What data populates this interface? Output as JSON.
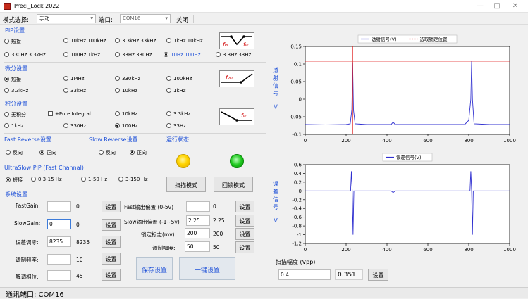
{
  "window": {
    "title": "Preci_Lock 2022",
    "min": "—",
    "max": "□",
    "close": "✕"
  },
  "toolbar": {
    "mode_label": "模式选择:",
    "mode_value": "手动",
    "port_label": "端口:",
    "port_value": "COM16",
    "close_label": "关闭"
  },
  "pip": {
    "title": "PIP设置",
    "row1": [
      "短接",
      "10kHz 100kHz",
      "3.3kHz 33kHz",
      "1kHz 10kHz"
    ],
    "row2": [
      "330Hz 3.3kHz",
      "100Hz 1kHz",
      "33Hz 330Hz",
      "10Hz 100Hz",
      "3.3Hz 33Hz"
    ],
    "selected": "10Hz 100Hz",
    "icon": {
      "left": "f",
      "left_sub": "PI",
      "right": "f",
      "right_sub": "IP"
    }
  },
  "diff": {
    "title": "微分设置",
    "row1": [
      "短接",
      "1MHz",
      "330kHz",
      "100kHz"
    ],
    "row2": [
      "3.3kHz",
      "33kHz",
      "10kHz",
      "1kHz"
    ],
    "selected": "短接",
    "icon": {
      "label": "f",
      "label_sub": "PD"
    }
  },
  "integ": {
    "title": "积分设置",
    "row1": [
      "无积分",
      "+Pure Integral",
      "10kHz",
      "3.3kHz"
    ],
    "row2": [
      "1kHz",
      "330Hz",
      "100Hz",
      "33Hz"
    ],
    "selected": "100Hz",
    "icon": {
      "label": "f",
      "label_sub": "IP"
    }
  },
  "fast_rev": {
    "title": "Fast Reverse设置",
    "opts": [
      "反向",
      "正向"
    ],
    "selected": "正向"
  },
  "slow_rev": {
    "title": "Slow Reverse设置",
    "opts": [
      "反向",
      "正向"
    ],
    "selected": "正向"
  },
  "run_state": {
    "title": "运行状态",
    "led1_color": "#ffd400",
    "led2_color": "#1ec81e"
  },
  "ultraslow": {
    "title": "UltraSlow PIP (Fast Channal)",
    "opts": [
      "短接",
      "0.3-15 Hz",
      "1-50 Hz",
      "3-150 Hz"
    ],
    "selected": "短接"
  },
  "mode_buttons": {
    "scan": "扫描模式",
    "lock": "回锁模式"
  },
  "sys": {
    "title": "系统设置",
    "fastgain": {
      "label": "FastGain:",
      "input": "",
      "value": "0",
      "btn": "设置"
    },
    "slowgain": {
      "label": "SlowGain:",
      "input": "0",
      "value": "0",
      "btn": "设置"
    },
    "err_zero": {
      "label": "误差调零:",
      "input": "8235",
      "value": "8235",
      "btn": "设置"
    },
    "mod_freq": {
      "label": "调制频率:",
      "input": "",
      "value": "10",
      "btn": "设置"
    },
    "demod_phase": {
      "label": "解调相位:",
      "input": "",
      "value": "45",
      "btn": "设置"
    },
    "fast_offset": {
      "label": "Fast输出偏置 (0-5v)",
      "input": "",
      "value": "0",
      "btn": "设置"
    },
    "slow_offset": {
      "label": "Slow输出偏置 (-1~5v)",
      "input": "2.25",
      "value": "2.25",
      "btn": "设置"
    },
    "lock_flag": {
      "label": "锁定标志(mv):",
      "input": "200",
      "value": "200",
      "btn": "设置"
    },
    "mod_amp": {
      "label": "调制幅度:",
      "input": "50",
      "value": "50",
      "btn": "设置"
    },
    "save_btn": "保存设置",
    "onekey_btn": "一键设置"
  },
  "scan_amp": {
    "label": "扫描幅度 (Vpp)",
    "input": "0.4",
    "value": "0.351",
    "btn": "设置"
  },
  "status": {
    "text": "通讯端口: COM16"
  },
  "chart_data": [
    {
      "type": "line",
      "ylabel": "透射信号 V",
      "xlim": [
        0,
        1000
      ],
      "ylim": [
        -0.1,
        0.15
      ],
      "xticks": [
        0,
        200,
        400,
        600,
        800,
        1000
      ],
      "yticks": [
        -0.1,
        -0.05,
        0,
        0.05,
        0.1,
        0.15
      ],
      "series": [
        {
          "name": "透射信号(V)",
          "color": "#3030d0",
          "x": [
            0,
            100,
            200,
            220,
            228,
            232,
            236,
            244,
            300,
            420,
            430,
            440,
            500,
            600,
            700,
            780,
            800,
            810,
            814,
            818,
            826,
            900,
            1000
          ],
          "y": [
            -0.072,
            -0.073,
            -0.072,
            -0.07,
            -0.03,
            0.105,
            -0.03,
            -0.07,
            -0.072,
            -0.072,
            -0.065,
            -0.072,
            -0.072,
            -0.072,
            -0.072,
            -0.072,
            -0.06,
            0.0,
            0.108,
            0.0,
            -0.07,
            -0.072,
            -0.072
          ]
        },
        {
          "name": "选取锁定位置",
          "color": "#e02020",
          "hline": 0.108,
          "vline": 232
        }
      ],
      "legend": "top"
    },
    {
      "type": "line",
      "ylabel": "误差信号 V",
      "xlim": [
        0,
        1000
      ],
      "ylim": [
        -1.2,
        0.6
      ],
      "xticks": [
        0,
        200,
        400,
        600,
        800,
        1000
      ],
      "yticks": [
        -1.2,
        -1.0,
        -0.8,
        -0.6,
        -0.4,
        -0.2,
        0,
        0.2,
        0.4,
        0.6
      ],
      "series": [
        {
          "name": "误差信号(V)",
          "color": "#3030d0",
          "x": [
            0,
            200,
            222,
            226,
            230,
            234,
            238,
            242,
            300,
            420,
            430,
            440,
            500,
            600,
            700,
            780,
            806,
            810,
            814,
            818,
            822,
            826,
            900,
            1000
          ],
          "y": [
            0,
            0,
            0,
            0.45,
            0,
            -1.0,
            0,
            0,
            0,
            0,
            -0.04,
            0,
            0,
            0,
            0,
            0,
            0,
            0.45,
            0,
            -1.0,
            0,
            0,
            0,
            0
          ]
        }
      ],
      "legend": "top"
    }
  ]
}
